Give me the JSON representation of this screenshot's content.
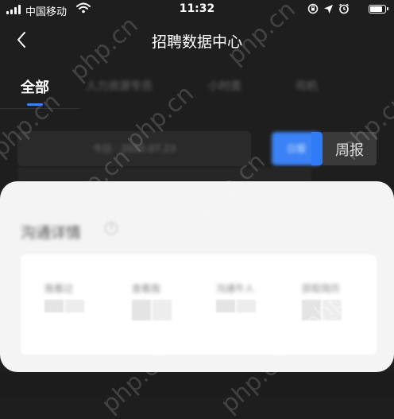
{
  "status_bar": {
    "carrier": "中国移动",
    "time": "11:32",
    "battery_level": 0.95,
    "icons": [
      "signal-icon",
      "wifi-icon",
      "rotation-lock-icon",
      "location-icon",
      "alarm-icon",
      "battery-icon"
    ]
  },
  "nav": {
    "back_icon": "chevron-left-icon",
    "title": "招聘数据中心"
  },
  "tabs": [
    {
      "label": "全部",
      "active": true
    },
    {
      "label": "人力资源专员",
      "active": false
    },
    {
      "label": "小时类",
      "active": false
    },
    {
      "label": "司机",
      "active": false
    }
  ],
  "filter": {
    "date_text": "今日 · 2020.07.23",
    "day_button": "日报",
    "week_button": "周报"
  },
  "card": {
    "title": "沟通详情",
    "help_icon": "question-circle-icon",
    "stats": [
      {
        "label": "我看过"
      },
      {
        "label": "查看我"
      },
      {
        "label": "沟通牛人"
      },
      {
        "label": "获取简历"
      }
    ]
  },
  "watermark": "php.cn",
  "colors": {
    "background": "#1e1e1e",
    "accent": "#3b82f6",
    "card": "#f4f4f4"
  }
}
